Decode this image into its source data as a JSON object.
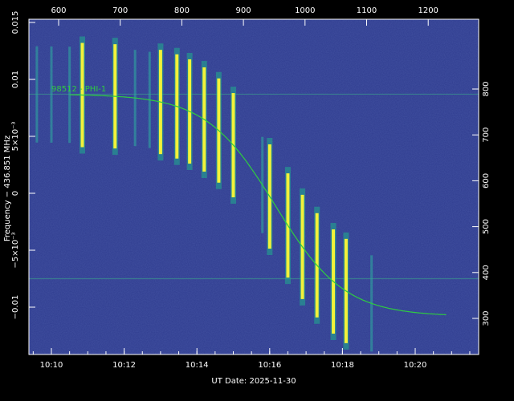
{
  "chart_data": {
    "type": "spectrogram",
    "xlabel": "UT Date: 2025-11-30",
    "ylabel": "Frequency − 436.851 MHz",
    "bottom_ticks": [
      "10:10",
      "10:12",
      "10:14",
      "10:16",
      "10:18",
      "10:20"
    ],
    "bottom_tick_minutes": [
      0,
      2,
      4,
      6,
      8,
      10
    ],
    "top_ticks": [
      "600",
      "700",
      "800",
      "900",
      "1000",
      "1100",
      "1200"
    ],
    "left_ticks": [
      {
        "label": "0.015",
        "value": 0.015
      },
      {
        "label": "0.01",
        "value": 0.01
      },
      {
        "label": "5×10⁻³",
        "value": 0.005
      },
      {
        "label": "0",
        "value": 0
      },
      {
        "label": "−5×10⁻³",
        "value": -0.005
      },
      {
        "label": "−0.01",
        "value": -0.01
      }
    ],
    "right_ticks": [
      "300",
      "400",
      "500",
      "600",
      "700",
      "800"
    ],
    "annotation": "98512 - PHI-1",
    "colors": {
      "background": "#2f3c8f",
      "signal": "#f2f23a",
      "curve": "#2ecc40",
      "hline": "#3a8a8f"
    },
    "doppler_curve": {
      "f_start": 0.0087,
      "f_end": -0.0108,
      "t_mid_minutes": 6.15,
      "tau_minutes": 0.95,
      "t_start_minutes": 0.5,
      "t_end_minutes": 10.9
    },
    "signal_pulses_minutes": [
      0.85,
      1.75,
      3.0,
      3.45,
      3.8,
      4.2,
      4.6,
      5.0,
      6.0,
      6.5,
      6.9,
      7.3,
      7.75,
      8.1
    ],
    "faint_pulses_minutes": [
      -0.4,
      0.0,
      0.5,
      2.3,
      2.7,
      5.8,
      8.8
    ],
    "horizontal_lines": [
      0.0087,
      -0.0075
    ]
  }
}
